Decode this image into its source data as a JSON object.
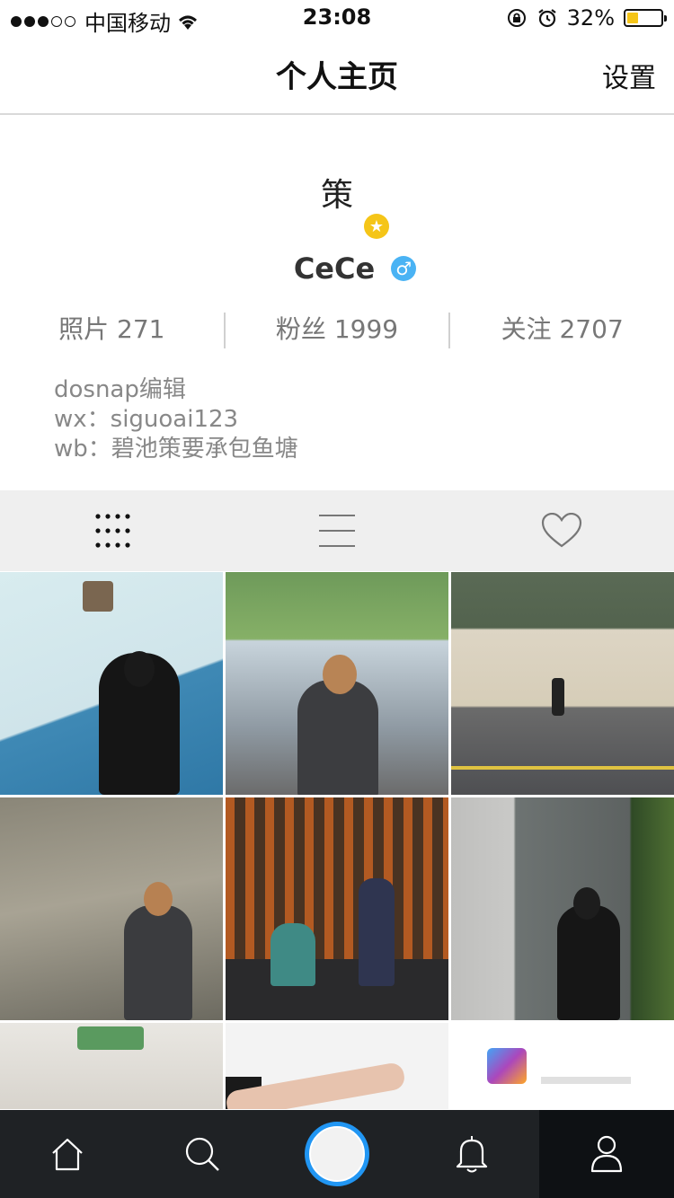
{
  "status_bar": {
    "carrier": "中国移动",
    "time": "23:08",
    "battery": "32%",
    "battery_level": 0.32,
    "icons": [
      "signal-dots",
      "wifi-icon",
      "rotation-lock-icon",
      "alarm-icon",
      "battery-icon"
    ]
  },
  "nav": {
    "title": "个人主页",
    "settings_label": "设置"
  },
  "profile": {
    "avatar_text": "策",
    "username": "CeCe",
    "verified_icon": "star-badge-icon",
    "gender_icon": "male-icon",
    "stats": {
      "photos": "照片 271",
      "fans": "粉丝 1999",
      "following": "关注 2707"
    },
    "bio": [
      "dosnap编辑",
      "wx：siguoai123",
      "wb：碧池策要承包鱼塘"
    ]
  },
  "view_tabs": [
    {
      "name": "grid-view",
      "icon": "grid-icon",
      "active": true
    },
    {
      "name": "list-view",
      "icon": "list-icon",
      "active": false
    },
    {
      "name": "liked-view",
      "icon": "heart-icon",
      "active": false
    }
  ],
  "tab_bar": [
    {
      "name": "home",
      "icon": "home-icon",
      "active": false
    },
    {
      "name": "search",
      "icon": "search-icon",
      "active": false
    },
    {
      "name": "capture",
      "icon": "capture-button-icon",
      "active": false
    },
    {
      "name": "notifications",
      "icon": "bell-icon",
      "active": false
    },
    {
      "name": "profile",
      "icon": "person-icon",
      "active": true
    }
  ],
  "colors": {
    "accent_blue": "#2196f3",
    "badge_yellow": "#f5c518",
    "gender_blue": "#4ab3f4",
    "tab_bar_bg": "#1f2225"
  }
}
